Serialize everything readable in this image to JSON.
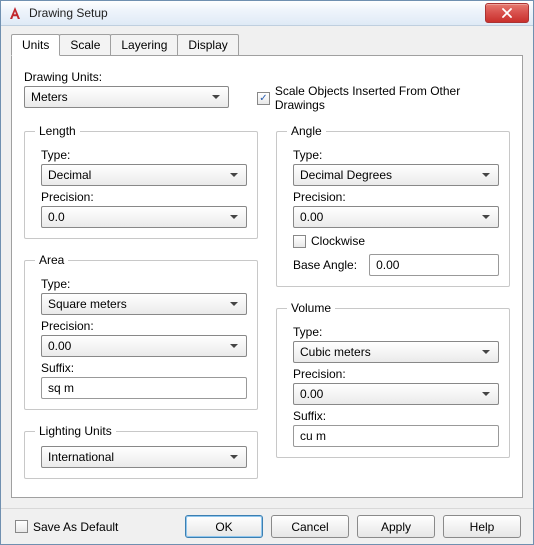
{
  "window": {
    "title": "Drawing Setup"
  },
  "tabs": {
    "units": "Units",
    "scale": "Scale",
    "layering": "Layering",
    "display": "Display"
  },
  "drawing_units": {
    "label": "Drawing Units:",
    "value": "Meters"
  },
  "scale_inserted": {
    "label": "Scale Objects Inserted From Other Drawings",
    "checked": true
  },
  "length": {
    "legend": "Length",
    "type_label": "Type:",
    "type_value": "Decimal",
    "precision_label": "Precision:",
    "precision_value": "0.0"
  },
  "area": {
    "legend": "Area",
    "type_label": "Type:",
    "type_value": "Square meters",
    "precision_label": "Precision:",
    "precision_value": "0.00",
    "suffix_label": "Suffix:",
    "suffix_value": "sq m"
  },
  "lighting": {
    "legend": "Lighting Units",
    "value": "International"
  },
  "angle": {
    "legend": "Angle",
    "type_label": "Type:",
    "type_value": "Decimal Degrees",
    "precision_label": "Precision:",
    "precision_value": "0.00",
    "clockwise_label": "Clockwise",
    "clockwise_checked": false,
    "base_angle_label": "Base Angle:",
    "base_angle_value": "0.00"
  },
  "volume": {
    "legend": "Volume",
    "type_label": "Type:",
    "type_value": "Cubic meters",
    "precision_label": "Precision:",
    "precision_value": "0.00",
    "suffix_label": "Suffix:",
    "suffix_value": "cu m"
  },
  "footer": {
    "save_default_label": "Save As Default",
    "save_default_checked": false,
    "ok": "OK",
    "cancel": "Cancel",
    "apply": "Apply",
    "help": "Help"
  }
}
